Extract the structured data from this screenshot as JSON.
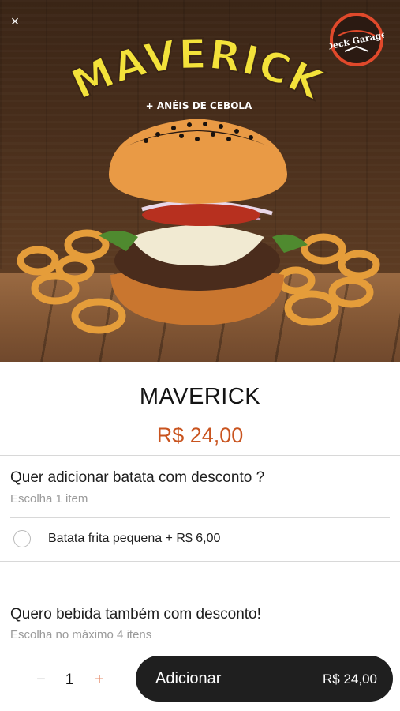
{
  "hero": {
    "headline": "MAVERICK",
    "tagline": "+ ANÉIS DE CEBOLA",
    "brand": "Deck Garage"
  },
  "header": {
    "close_label": "×"
  },
  "product": {
    "name": "MAVERICK",
    "price": "R$ 24,00"
  },
  "groups": [
    {
      "title": "Quer adicionar batata com desconto ?",
      "hint": "Escolha 1 item",
      "options": [
        {
          "label": "Batata frita pequena + R$ 6,00",
          "selected": false
        }
      ]
    },
    {
      "title": "Quero bebida também com desconto!",
      "hint": "Escolha no máximo 4 itens"
    }
  ],
  "footer": {
    "minus_label": "−",
    "quantity": "1",
    "plus_label": "+",
    "add_label": "Adicionar",
    "add_price": "R$ 24,00"
  },
  "colors": {
    "accent": "#c9541f",
    "button_bg": "#1f1f1f",
    "headline": "#f3e23a"
  },
  "icons": {
    "close": "close-icon",
    "radio": "radio-icon",
    "logo": "deck-garage-logo"
  }
}
